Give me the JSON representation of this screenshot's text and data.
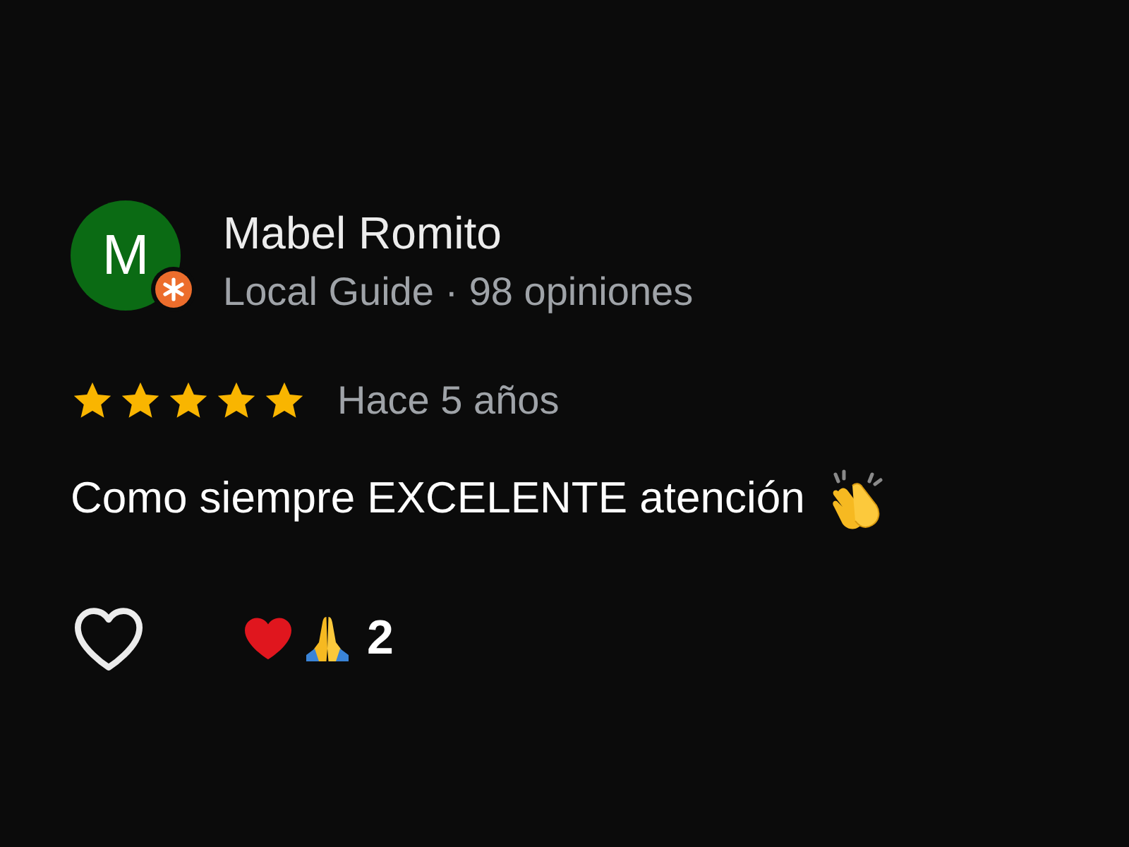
{
  "review": {
    "avatar": {
      "initial": "M",
      "color": "#0b6b14",
      "local_guide": true
    },
    "author": "Mabel Romito",
    "author_info": "Local Guide · 98 opiniones",
    "stars": 5,
    "time": "Hace 5 años",
    "text": "Como siempre EXCELENTE atención",
    "liked": false,
    "reactions": {
      "count": "2"
    }
  }
}
